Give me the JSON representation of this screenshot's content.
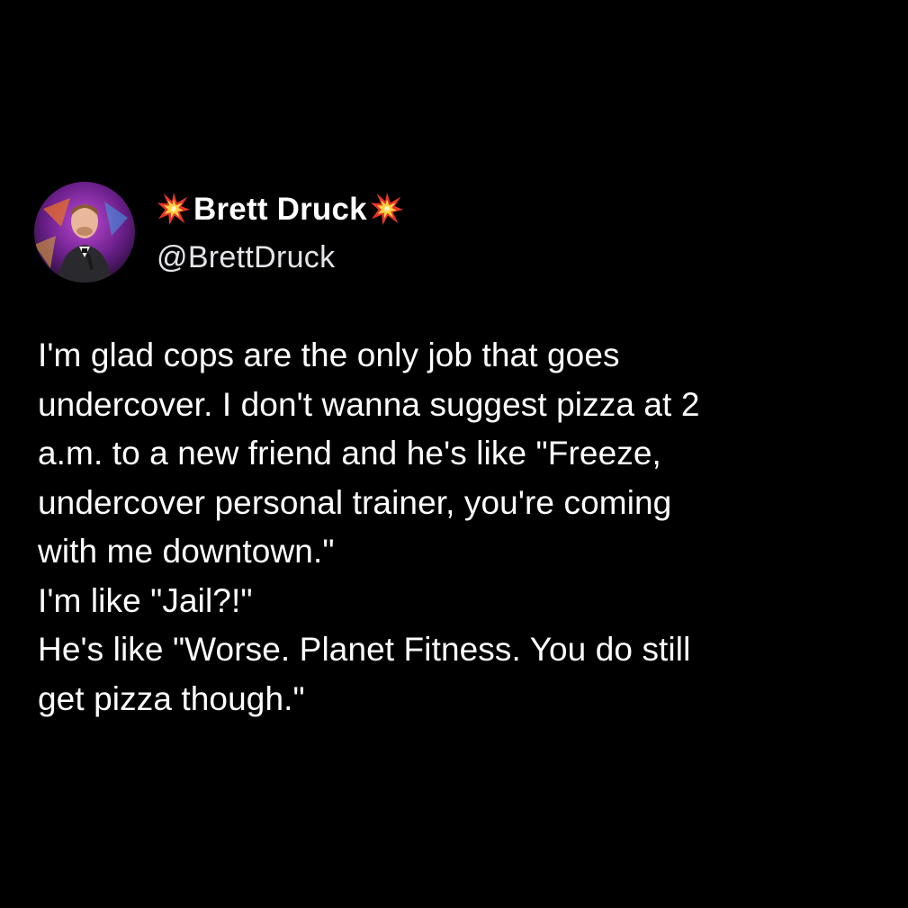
{
  "author": {
    "display_name": "Brett Druck",
    "handle": "@BrettDruck",
    "name_decoration_icon": "collision-burst-emoji",
    "avatar_icon": "profile-photo"
  },
  "tweet": {
    "lines": [
      "I'm glad cops are the only job that goes",
      "undercover. I don't wanna suggest pizza at 2",
      "a.m. to a new friend and he's like \"Freeze,",
      "undercover personal trainer, you're coming",
      "with me downtown.\"",
      "I'm like \"Jail?!\"",
      "He's like \"Worse. Planet Fitness. You do still",
      "get pizza though.\""
    ]
  },
  "colors": {
    "background": "#000000",
    "text_primary": "#ffffff",
    "text_secondary": "#e2e4e7",
    "burst_outer": "#e8352a",
    "burst_inner": "#ffd23f"
  }
}
